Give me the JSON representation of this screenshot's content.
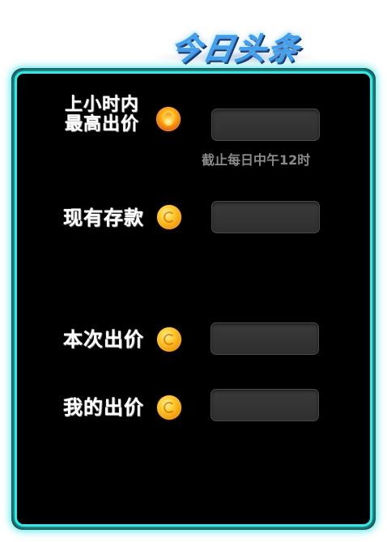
{
  "title": "今日头条",
  "rows": [
    {
      "label": "上小时内最高出价",
      "label_line1": "上小时内",
      "label_line2": "最高出价",
      "icon": "fire-coin-icon"
    },
    {
      "label": "现有存款",
      "icon": "gold-coin-icon"
    },
    {
      "label": "本次出价",
      "icon": "gold-coin-icon"
    },
    {
      "label": "我的出价",
      "icon": "gold-coin-icon"
    }
  ],
  "note": "截止每日中午12时",
  "colors": {
    "panel_border": "#37e7e6",
    "panel_bg": "#000000",
    "field_bg": "#333333",
    "note": "#8a8a8a"
  }
}
